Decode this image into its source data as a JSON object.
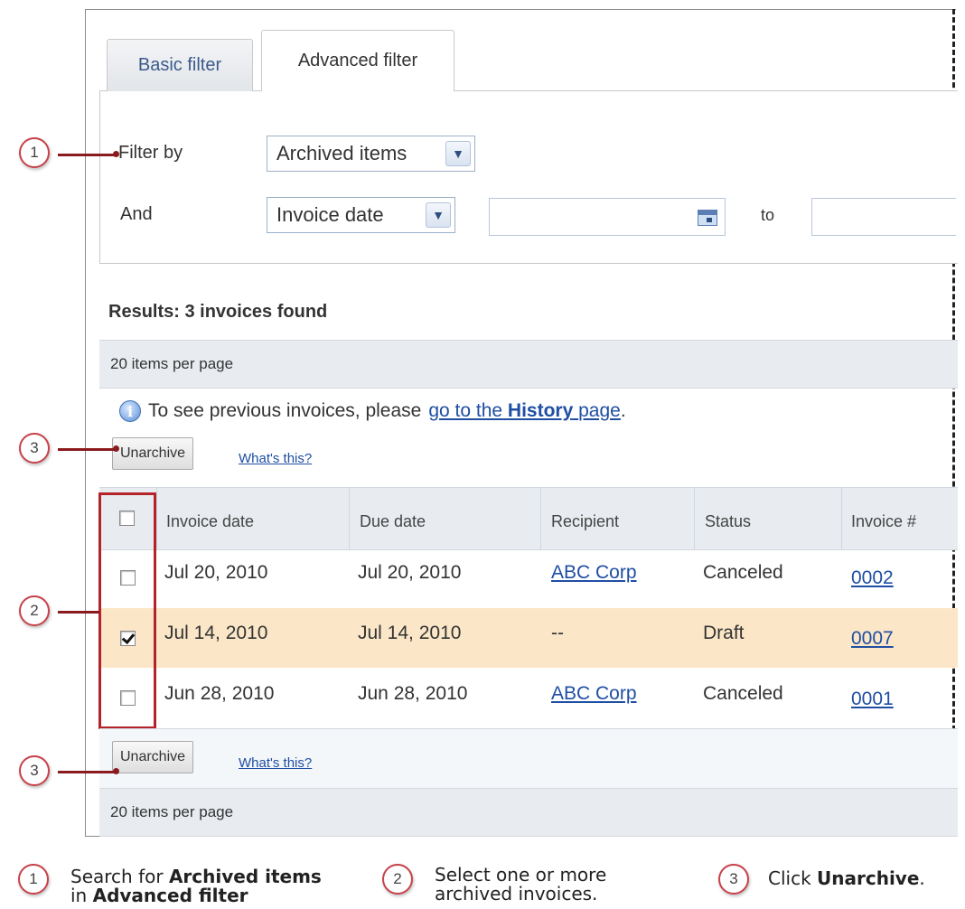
{
  "tabs": {
    "basic": "Basic filter",
    "advanced": "Advanced filter"
  },
  "filter": {
    "filter_by_label": "Filter by",
    "filter_by_value": "Archived items",
    "and_label": "And",
    "and_value": "Invoice date",
    "to_label": "to"
  },
  "results": {
    "title": "Results: 3 invoices found"
  },
  "pagination": {
    "items_per_page": "20 items per page"
  },
  "info": {
    "text": "To see previous invoices, please",
    "link_prefix": "go to the",
    "link_bold": "History",
    "link_suffix": "page",
    "end": "."
  },
  "actions": {
    "unarchive": "Unarchive",
    "whats_this": "What's this?"
  },
  "table": {
    "headers": [
      "Invoice date",
      "Due date",
      "Recipient",
      "Status",
      "Invoice #"
    ],
    "rows": [
      {
        "invoice_date": "Jul 20, 2010",
        "due_date": "Jul 20, 2010",
        "recipient": "ABC Corp",
        "status": "Canceled",
        "invoice_no": "0002",
        "checked": false
      },
      {
        "invoice_date": "Jul 14, 2010",
        "due_date": "Jul 14, 2010",
        "recipient": "--",
        "status": "Draft",
        "invoice_no": "0007",
        "checked": true
      },
      {
        "invoice_date": "Jun 28, 2010",
        "due_date": "Jun 28, 2010",
        "recipient": "ABC Corp",
        "status": "Canceled",
        "invoice_no": "0001",
        "checked": false
      }
    ]
  },
  "callouts": {
    "one": "1",
    "two": "2",
    "three": "3"
  },
  "legend": {
    "step1": {
      "pre": "Search for",
      "bold1": "Archived items",
      "mid": "in",
      "bold2": "Advanced filter"
    },
    "step2": {
      "line1": "Select one or more",
      "line2": "archived invoices."
    },
    "step3": {
      "pre": "Click",
      "bold": "Unarchive",
      "end": "."
    }
  },
  "colors": {
    "highlight_row": "#fbe7c7",
    "callout_red": "#b5232a",
    "link_blue": "#1f4ea3"
  }
}
